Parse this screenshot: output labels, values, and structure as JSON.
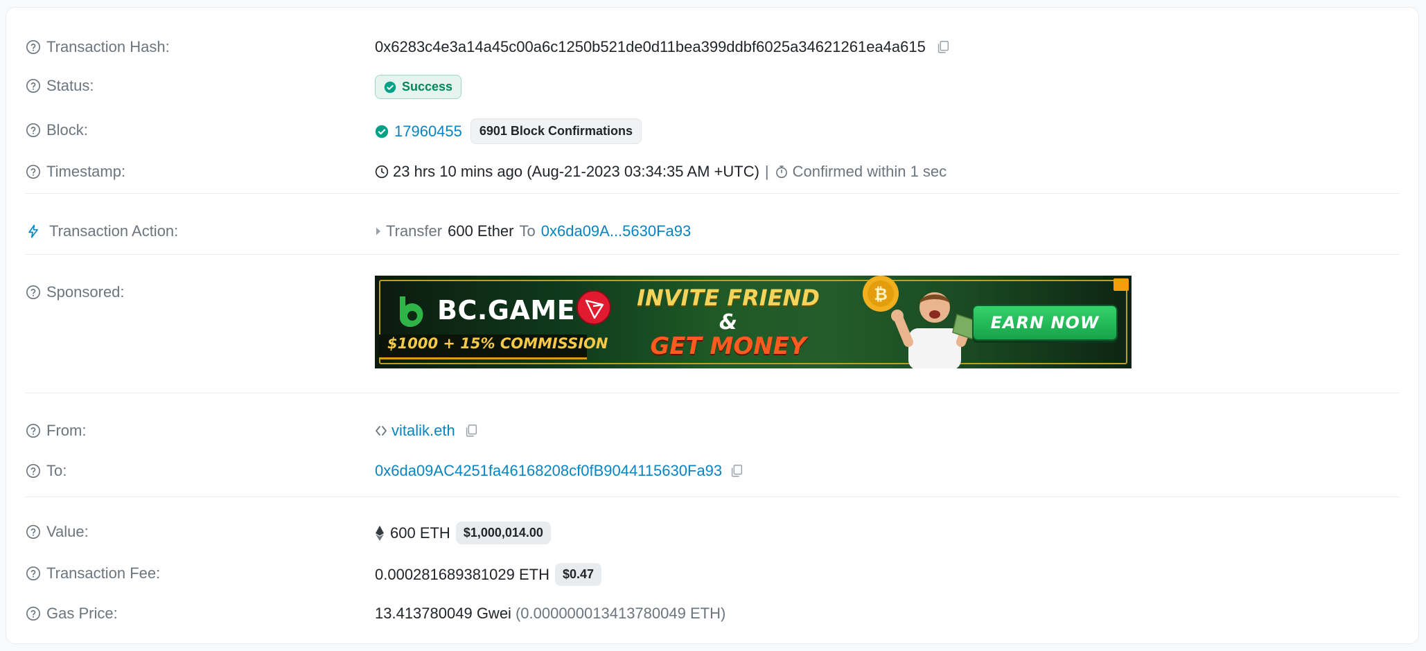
{
  "rows": {
    "tx_hash": {
      "label": "Transaction Hash:",
      "value": "0x6283c4e3a14a45c00a6c1250b521de0d11bea399ddbf6025a34621261ea4a615"
    },
    "status": {
      "label": "Status:",
      "value": "Success"
    },
    "block": {
      "label": "Block:",
      "number": "17960455",
      "confirmations": "6901 Block Confirmations"
    },
    "timestamp": {
      "label": "Timestamp:",
      "value": "23 hrs 10 mins ago (Aug-21-2023 03:34:35 AM +UTC)",
      "separator": "|",
      "confirmed": "Confirmed within 1 sec"
    },
    "tx_action": {
      "label": "Transaction Action:",
      "verb": "Transfer",
      "amount": "600 Ether",
      "to_word": "To",
      "to_address": "0x6da09A...5630Fa93"
    },
    "sponsored": {
      "label": "Sponsored:",
      "banner": {
        "brand": "BC.GAME",
        "commission": "$1000 + 15% COMMISSION",
        "line1": "INVITE FRIEND",
        "line2": "&",
        "line3": "GET MONEY",
        "cta": "EARN NOW"
      }
    },
    "from": {
      "label": "From:",
      "value": "vitalik.eth"
    },
    "to": {
      "label": "To:",
      "value": "0x6da09AC4251fa46168208cf0fB9044115630Fa93"
    },
    "value": {
      "label": "Value:",
      "amount": "600 ETH",
      "usd": "$1,000,014.00"
    },
    "fee": {
      "label": "Transaction Fee:",
      "amount": "0.000281689381029 ETH",
      "usd": "$0.47"
    },
    "gas": {
      "label": "Gas Price:",
      "gwei": "13.413780049 Gwei",
      "eth": "(0.000000013413780049 ETH)"
    }
  },
  "icons": {
    "help": "question-circle-icon",
    "copy": "copy-icon",
    "check": "check-circle-icon",
    "clock": "clock-icon",
    "stopwatch": "stopwatch-icon",
    "lightning": "lightning-icon",
    "caret": "caret-right-icon",
    "code": "code-icon",
    "eth": "ethereum-icon"
  },
  "colors": {
    "link": "#0784c3",
    "success": "#00865a",
    "muted": "#6c757d"
  }
}
